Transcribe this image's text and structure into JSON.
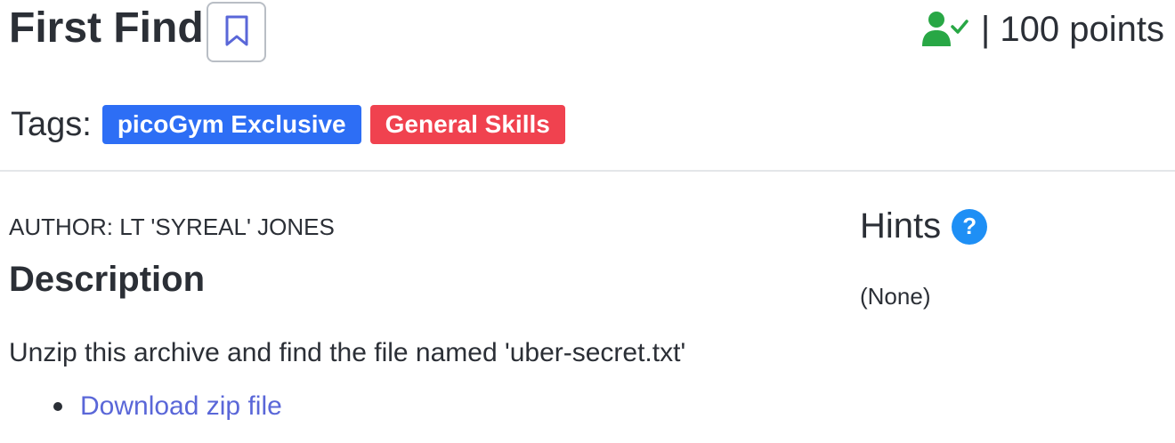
{
  "challenge": {
    "title": "First Find",
    "points_text": "| 100 points",
    "solved": true
  },
  "tags": {
    "label": "Tags:",
    "items": [
      {
        "label": "picoGym Exclusive",
        "color": "#2d6ef5"
      },
      {
        "label": "General Skills",
        "color": "#f0424f"
      }
    ]
  },
  "details": {
    "author": "AUTHOR: LT 'SYREAL' JONES",
    "description_heading": "Description",
    "description_text": "Unzip this archive and find the file named 'uber-secret.txt'",
    "download_label": "Download zip file"
  },
  "hints": {
    "title": "Hints",
    "help_icon_glyph": "?",
    "body": "(None)"
  },
  "icons": {
    "bookmark": "bookmark-icon",
    "solved_user": "user-check-icon",
    "help": "question-circle-icon"
  },
  "colors": {
    "accent_link": "#5a67d8",
    "solved_green": "#28a745",
    "help_blue": "#1e8ff5"
  }
}
